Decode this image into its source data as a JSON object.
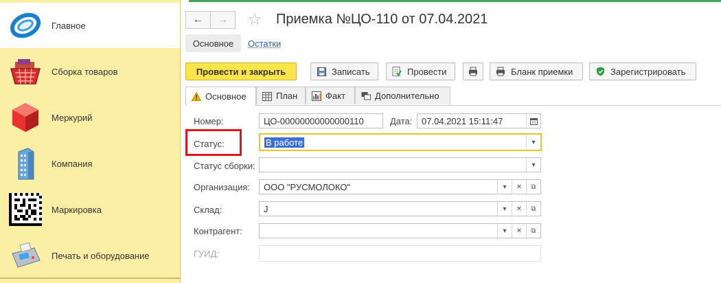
{
  "sidebar": {
    "items": [
      {
        "label": "Главное",
        "icon": "home-swirl-icon"
      },
      {
        "label": "Сборка товаров",
        "icon": "basket-icon"
      },
      {
        "label": "Меркурий",
        "icon": "red-cube-icon"
      },
      {
        "label": "Компания",
        "icon": "building-icon"
      },
      {
        "label": "Маркировка",
        "icon": "datamatrix-icon"
      },
      {
        "label": "Печать и оборудование",
        "icon": "pos-terminal-icon"
      }
    ]
  },
  "header": {
    "back": "←",
    "forward": "→",
    "star": "☆",
    "title": "Приемка №ЦО-110 от 07.04.2021"
  },
  "subtabs": {
    "main": "Основное",
    "link": "Остатки"
  },
  "toolbar": {
    "post_close": "Провести и закрыть",
    "write": "Записать",
    "post": "Провести",
    "print": "",
    "blank": "Бланк приемки",
    "register": "Зарегистрировать"
  },
  "tabs": [
    {
      "label": "Основное"
    },
    {
      "label": "План"
    },
    {
      "label": "Факт"
    },
    {
      "label": "Дополнительно"
    }
  ],
  "form": {
    "number_label": "Номер:",
    "number_value": "ЦО-00000000000000110",
    "date_label": "Дата:",
    "date_value": "07.04.2021 15:11:47",
    "status_label": "Статус:",
    "status_value": "В работе",
    "assembly_status_label": "Статус сборки:",
    "assembly_status_value": "",
    "org_label": "Организация:",
    "org_value": "ООО \"РУСМОЛОКО\"",
    "warehouse_label": "Склад:",
    "warehouse_value": "J",
    "counterparty_label": "Контрагент:",
    "counterparty_value": "",
    "guid_label": "ГУИД:",
    "guid_value": ""
  },
  "colors": {
    "sidebar_bg": "#fbeea5",
    "primary_button": "#fde44a",
    "highlight_box": "#e0141a",
    "selection": "#3b6fd4"
  }
}
